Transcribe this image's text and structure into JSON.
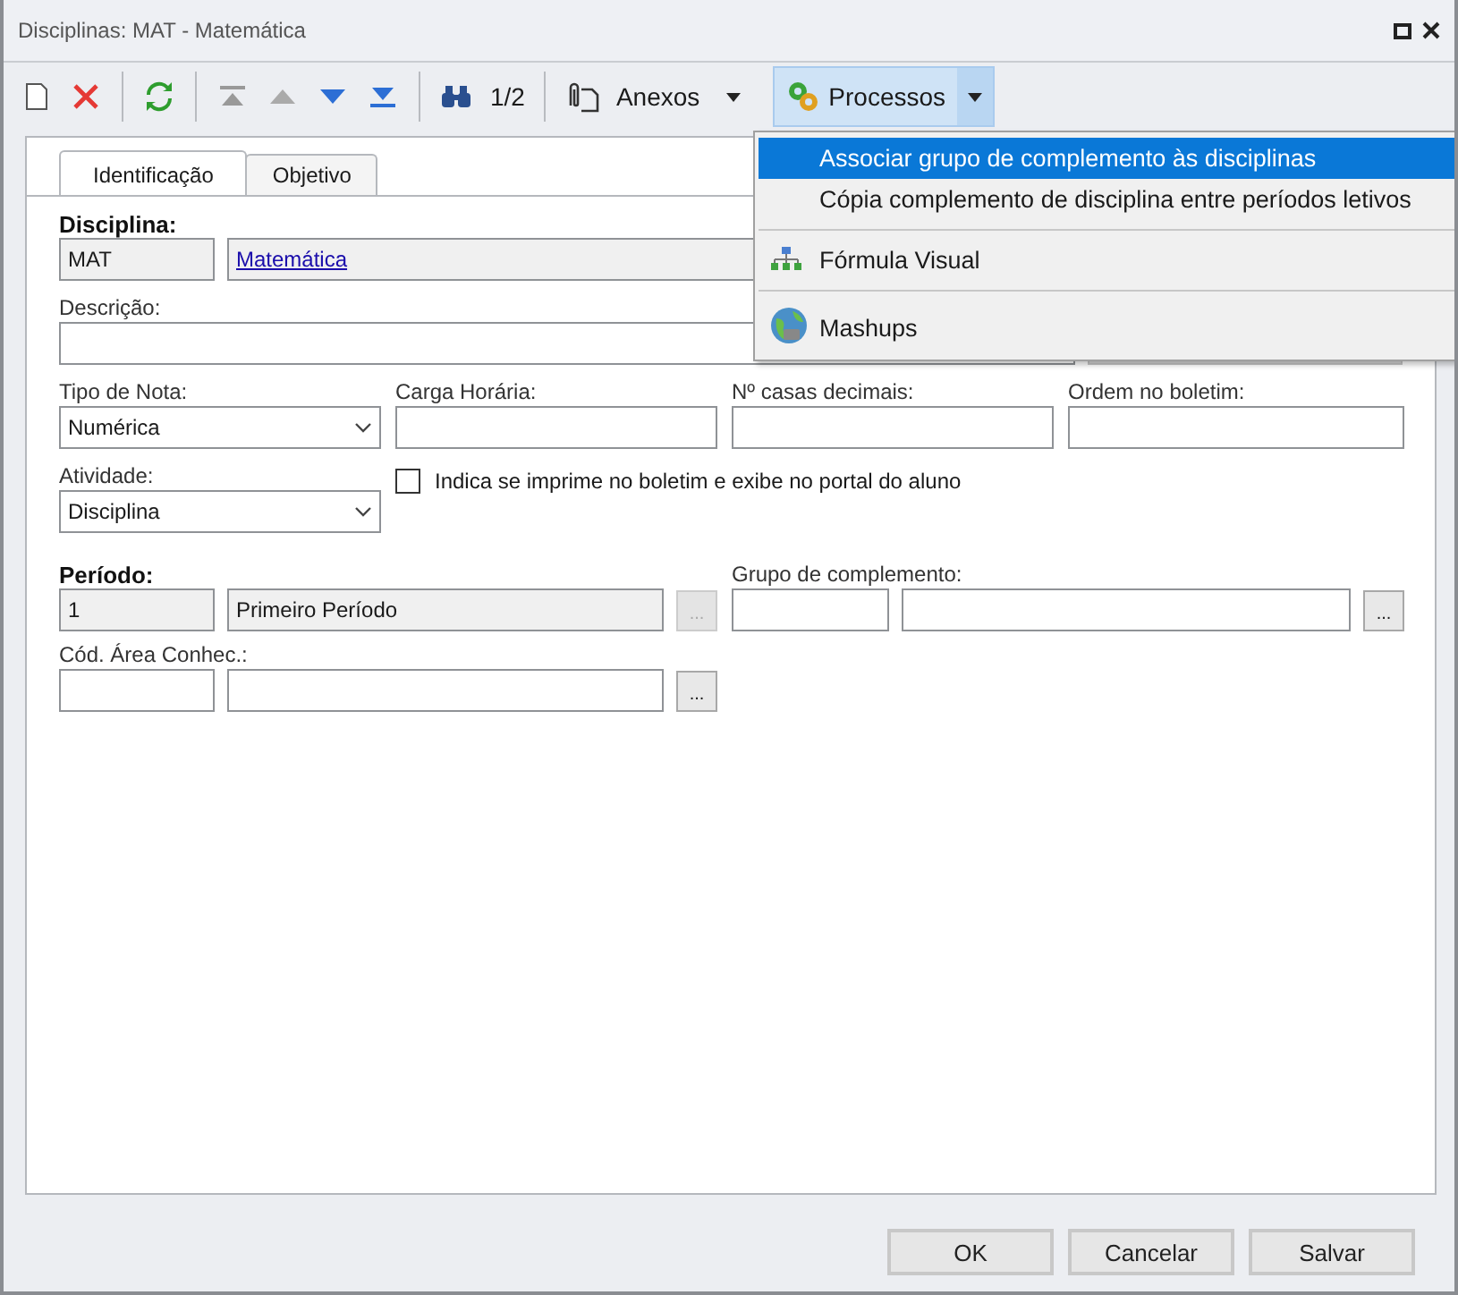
{
  "window": {
    "title": "Disciplinas: MAT - Matemática"
  },
  "toolbar": {
    "page": "1/2",
    "attachments": "Anexos",
    "processes": {
      "label": "Processos",
      "expanded": true
    }
  },
  "tabs": [
    {
      "label": "Identificação",
      "selected": true
    },
    {
      "label": "Objetivo",
      "selected": false
    }
  ],
  "form": {
    "disciplina": {
      "label": "Disciplina:",
      "code": "MAT",
      "name": "Matemática"
    },
    "descricao": {
      "label": "Descrição:"
    },
    "tipo_nota": {
      "label": "Tipo de Nota:",
      "value": "Numérica"
    },
    "carga_horaria": {
      "label": "Carga Horária:"
    },
    "casas_decimais": {
      "label": "Nº casas decimais:"
    },
    "ordem_boletim": {
      "label": "Ordem no boletim:"
    },
    "atividade": {
      "label": "Atividade:",
      "value": "Disciplina"
    },
    "imprime": {
      "label": "Indica se imprime no boletim e exibe no portal do aluno",
      "checked": false
    },
    "periodo": {
      "label": "Período:",
      "code": "1",
      "name": "Primeiro Período",
      "lookup": "...",
      "disabled": true
    },
    "grupo": {
      "label": "Grupo de complemento:",
      "lookup": "...",
      "disabled": false
    },
    "area": {
      "label": "Cód. Área Conhec.:",
      "lookup": "...",
      "disabled": false
    }
  },
  "menu": [
    {
      "kind": "text",
      "label": "Associar grupo de complemento às disciplinas",
      "selected": true
    },
    {
      "kind": "text",
      "label": "Cópia complemento de disciplina entre períodos letivos",
      "selected": false
    },
    {
      "kind": "separator"
    },
    {
      "kind": "formula",
      "label": "Fórmula Visual",
      "selected": false
    },
    {
      "kind": "separator"
    },
    {
      "kind": "globe",
      "label": "Mashups",
      "selected": false
    }
  ],
  "buttons": [
    "OK",
    "Cancelar",
    "Salvar"
  ]
}
